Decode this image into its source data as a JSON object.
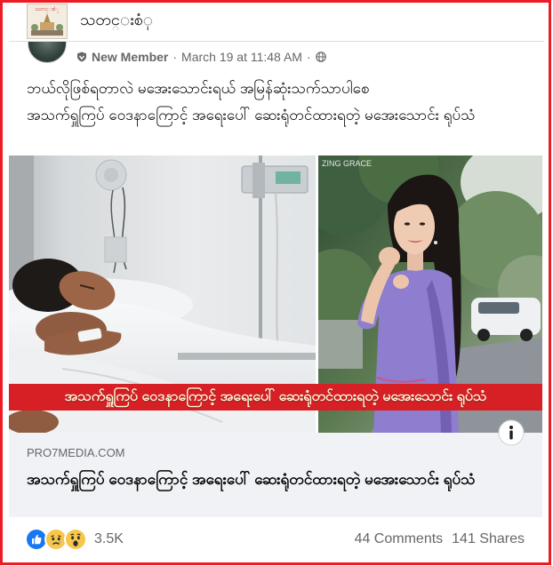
{
  "page_header": {
    "name": "သတင္းစံု",
    "logo_text": "သတင္းစံု"
  },
  "post": {
    "badge_label": "New Member",
    "separator": "·",
    "timestamp": "March 19 at 11:48 AM",
    "text": [
      "ဘယ်လိုဖြစ်ရတာလဲ မအေးသောင်းရယ် အမြန်ဆုံးသက်သာပါစေ",
      "အသက်ရှူကြပ် ဝေဒနာကြောင့် အရေးပေါ် ဆေးရုံတင်ထားရတဲ့ မအေးသောင်း ရုပ်သံ"
    ]
  },
  "media": {
    "banner_text": "အသက်ရှူကြပ် ဝေဒနာကြောင့် အရေးပေါ် ဆေးရုံတင်ထားရတဲ့ မအေးသောင်း ရုပ်သံ",
    "watermark": "ZING GRACE"
  },
  "link_preview": {
    "domain": "PRO7MEDIA.COM",
    "title": "အသက်ရှူကြပ် ဝေဒနာကြောင့် အရေးပေါ် ဆေးရုံတင်ထားရတဲ့ မအေးသောင်း ရုပ်သံ"
  },
  "footer": {
    "reaction_count": "3.5K",
    "comments": "44 Comments",
    "shares": "141 Shares"
  },
  "icons": {
    "page_logo": "page-logo-icon",
    "badge": "new-member-badge-icon",
    "privacy": "globe-icon",
    "info": "info-icon",
    "reactions": [
      "like-icon",
      "sad-icon",
      "wow-icon"
    ]
  },
  "colors": {
    "frame": "#ec1c24",
    "banner": "#d71f26",
    "banner_text": "#fff8d6",
    "secondary_text": "#65676b",
    "text_primary": "#050505",
    "preview_bg": "#f0f2f5",
    "like_blue": "#1877f2",
    "reaction_yellow": "#f7c64a"
  }
}
